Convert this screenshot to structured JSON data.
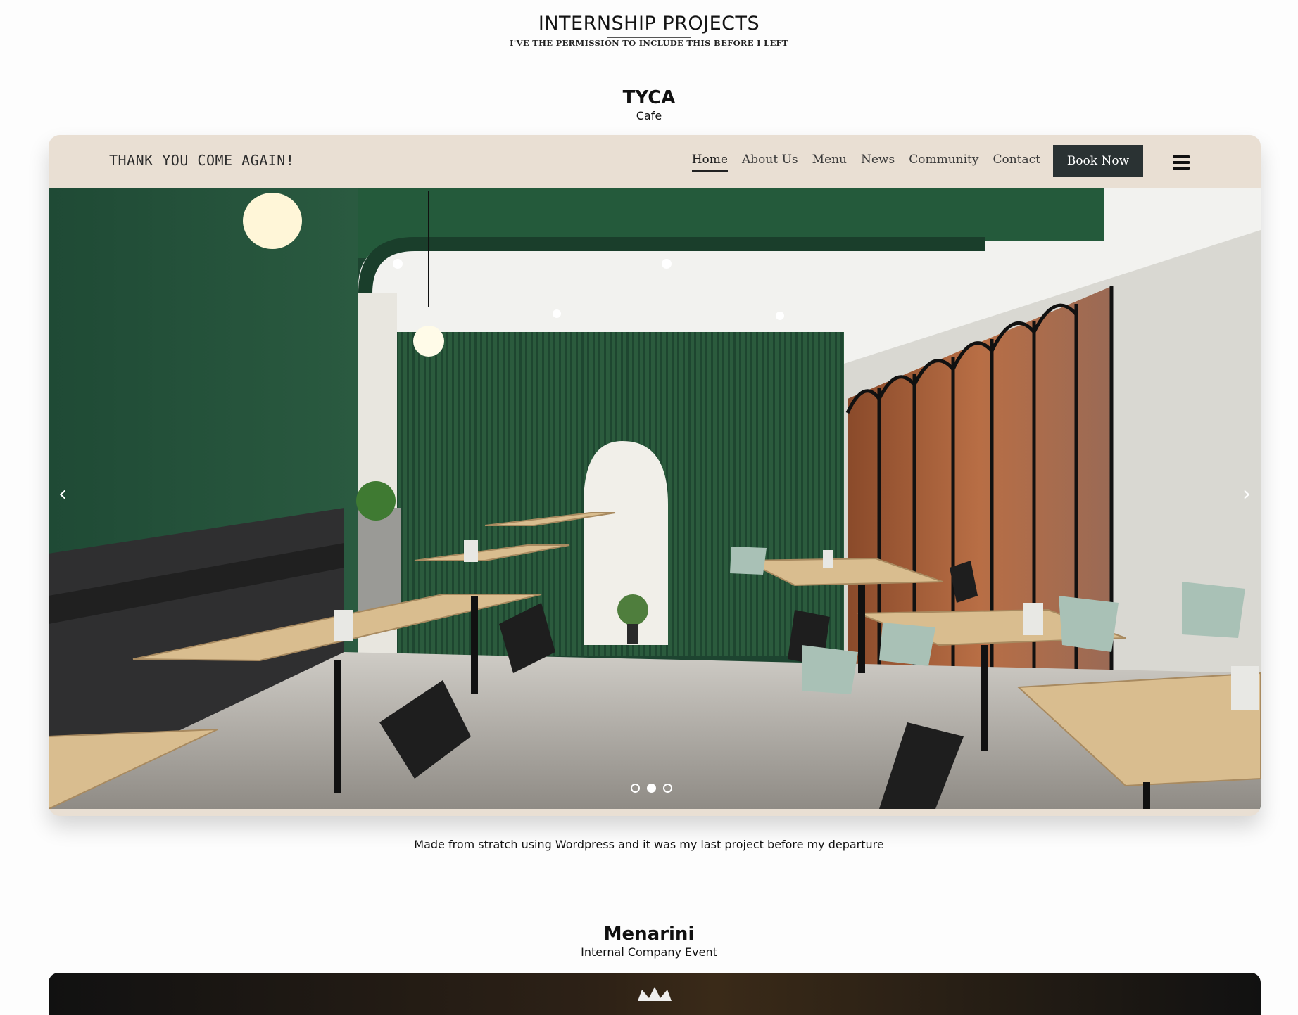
{
  "page": {
    "title": "INTERNSHIP PROJECTS",
    "subtitle": "I'VE THE PERMISSION TO INCLUDE THIS BEFORE I LEFT"
  },
  "projects": [
    {
      "name": "TYCA",
      "type": "Cafe",
      "caption": "Made from stratch using Wordpress and it was my last project before my departure",
      "site": {
        "logo": "THANK YOU COME AGAIN!",
        "nav": [
          "Home",
          "About Us",
          "Menu",
          "News",
          "Community",
          "Contact"
        ],
        "active_nav": "Home",
        "cta": "Book Now",
        "colors": {
          "nav_bg": "#e9dfd3",
          "cta_bg": "#2a3233"
        }
      },
      "slider": {
        "slides": 3,
        "active_slide": 2,
        "image": "cafe interior with green walls and wooden tables"
      }
    },
    {
      "name": "Menarini",
      "type": "Internal Company Event"
    }
  ]
}
